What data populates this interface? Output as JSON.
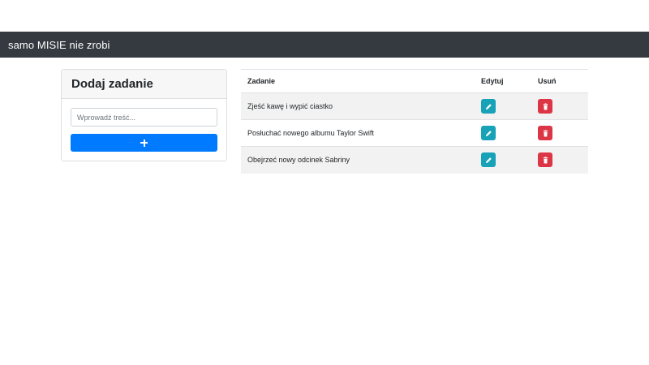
{
  "navbar": {
    "brand": "samo MISIE nie zrobi"
  },
  "add_card": {
    "title": "Dodaj zadanie",
    "input_placeholder": "Wprowadź treść...",
    "input_value": "",
    "add_button_icon": "plus-icon"
  },
  "table": {
    "headers": {
      "task": "Zadanie",
      "edit": "Edytuj",
      "delete": "Usuń"
    },
    "rows": [
      {
        "task": "Zjeść kawę i wypić ciastko"
      },
      {
        "task": "Posłuchać nowego albumu Taylor Swift"
      },
      {
        "task": "Obejrzeć nowy odcinek Sabriny"
      }
    ],
    "edit_icon": "pencil-icon",
    "delete_icon": "trash-icon"
  },
  "colors": {
    "navbar_bg": "#343a40",
    "primary": "#007bff",
    "info": "#17a2b8",
    "danger": "#dc3545",
    "striped_row": "#f2f2f2"
  }
}
